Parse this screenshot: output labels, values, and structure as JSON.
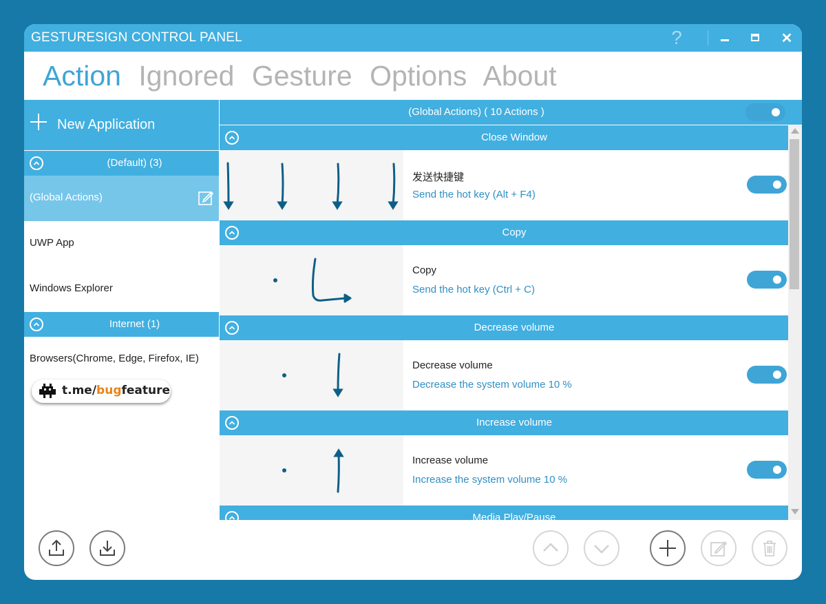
{
  "window": {
    "title": "GESTURESIGN CONTROL PANEL"
  },
  "titlebar": {
    "help_glyph": "?",
    "minimize_glyph": "▬",
    "maximize_glyph": "▭",
    "close_glyph": "✕"
  },
  "tabs": [
    {
      "label": "Action",
      "active": true
    },
    {
      "label": "Ignored",
      "active": false
    },
    {
      "label": "Gesture",
      "active": false
    },
    {
      "label": "Options",
      "active": false
    },
    {
      "label": "About",
      "active": false
    }
  ],
  "sidebar": {
    "new_application_label": "New Application",
    "groups": [
      {
        "label": "(Default) (3)",
        "items": [
          "(Global Actions)",
          "UWP App",
          "Windows Explorer"
        ]
      },
      {
        "label": "Internet (1)",
        "items": [
          "Browsers(Chrome, Edge, Firefox, IE)"
        ]
      }
    ],
    "selected_item": "(Global Actions)",
    "badge": {
      "prefix": "t.me/",
      "highlight": "bug",
      "suffix": "feature"
    }
  },
  "main": {
    "header": "(Global Actions)   ( 10 Actions )",
    "header_enabled": true,
    "actions": [
      {
        "header": "Close Window",
        "name": "发送快捷键",
        "description": "Send the hot key (Alt + F4)",
        "enabled": true
      },
      {
        "header": "Copy",
        "name": "Copy",
        "description": "Send the hot key (Ctrl + C)",
        "enabled": true
      },
      {
        "header": "Decrease volume",
        "name": "Decrease volume",
        "description": "Decrease the system volume 10 %",
        "enabled": true
      },
      {
        "header": "Increase volume",
        "name": "Increase volume",
        "description": "Increase the system volume 10 %",
        "enabled": true
      },
      {
        "header": "Media Play/Pause"
      }
    ]
  },
  "icons": {
    "titlebar": [
      "help-icon",
      "minimize-icon",
      "maximize-icon",
      "close-icon"
    ],
    "toolbar": [
      "export-icon",
      "import-icon",
      "move-up-icon",
      "move-down-icon",
      "add-icon",
      "edit-icon",
      "delete-icon"
    ]
  },
  "colors": {
    "accent": "#41afe0",
    "tab_active": "#3fa5d6",
    "selected_item": "#76c6ea",
    "description_text": "#2f8fc4",
    "background": "#1679a8"
  }
}
